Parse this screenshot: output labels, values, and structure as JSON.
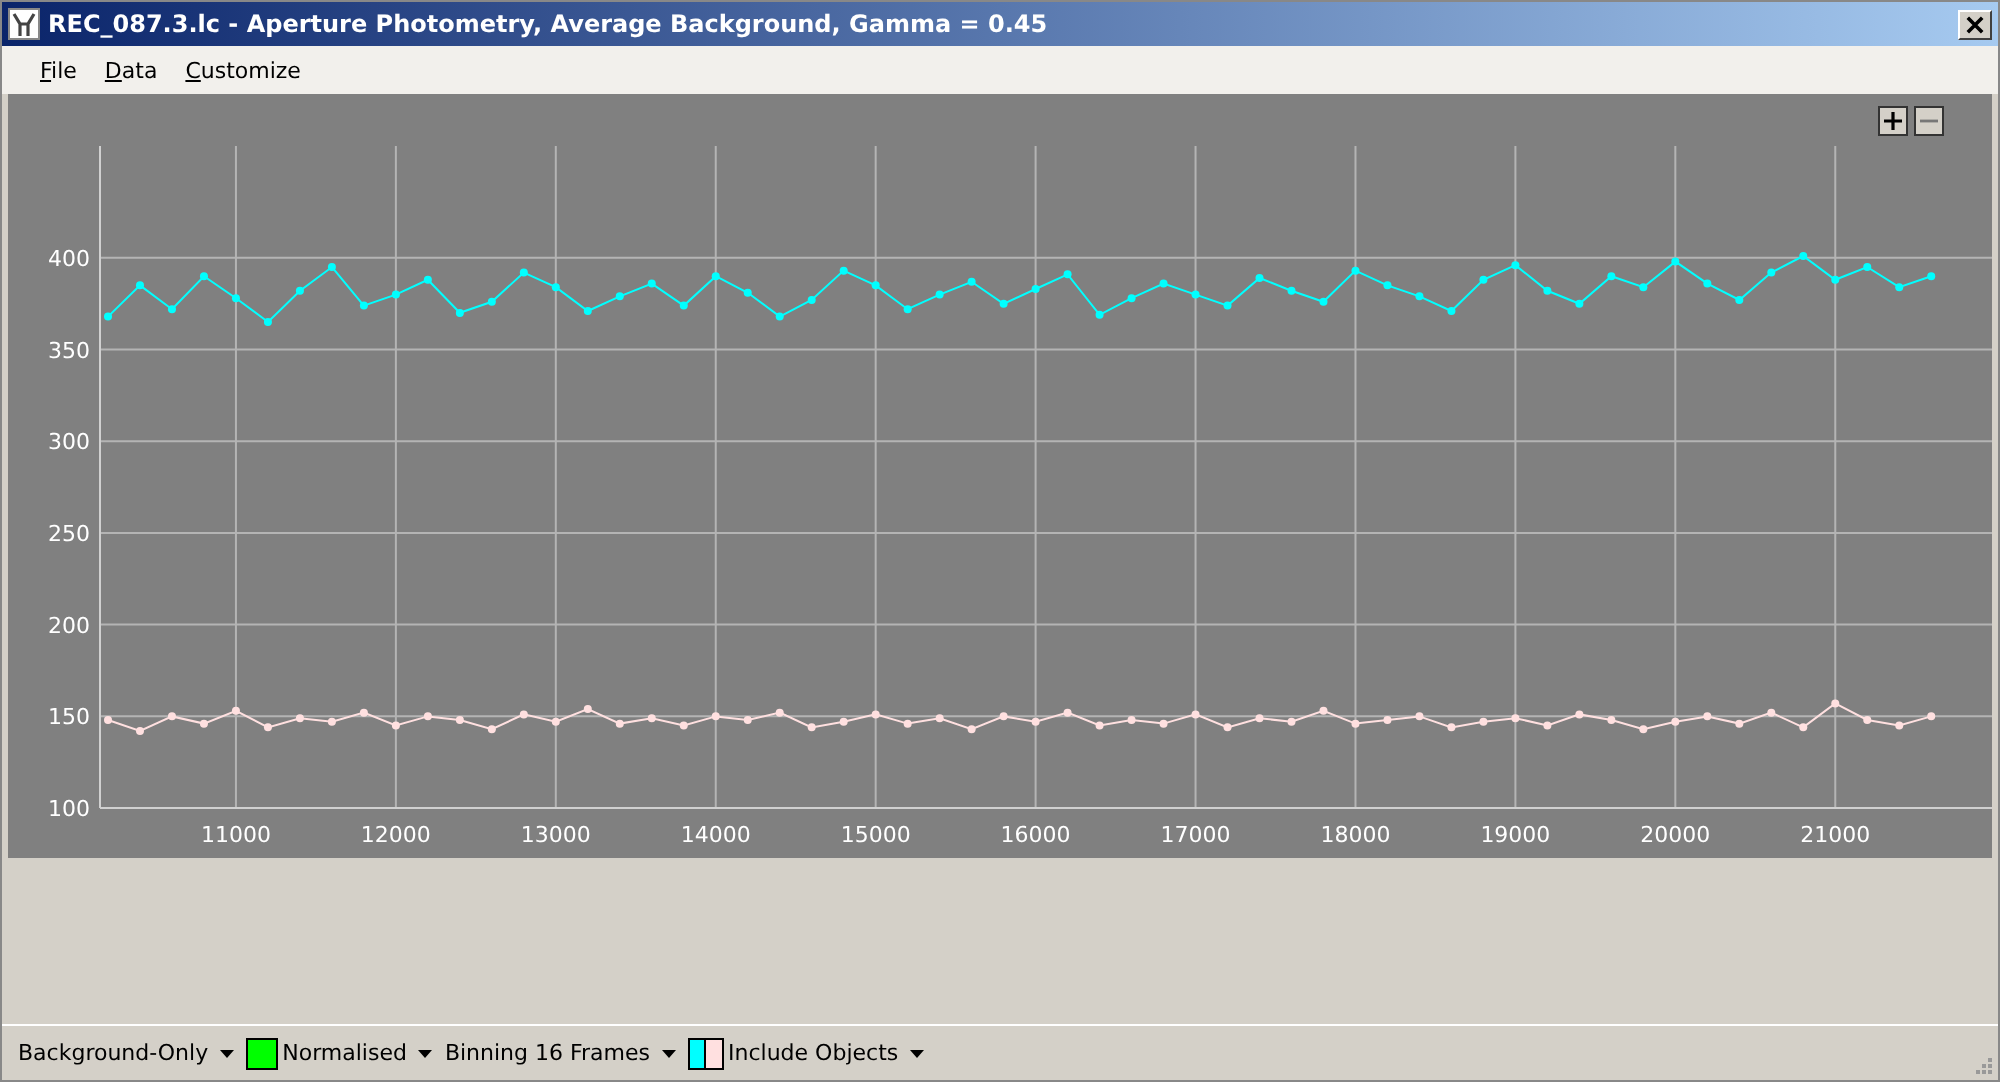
{
  "window": {
    "title": "REC_087.3.lc - Aperture Photometry, Average Background, Gamma = 0.45"
  },
  "menu": [
    "File",
    "Data",
    "Customize"
  ],
  "chart": {
    "chart_data": {
      "type": "line",
      "grid": true,
      "xlim": [
        10150,
        21980
      ],
      "ylim": [
        100,
        461
      ],
      "xticks": [
        11000,
        12000,
        13000,
        14000,
        15000,
        16000,
        17000,
        18000,
        19000,
        20000,
        21000
      ],
      "yticks": [
        100,
        150,
        200,
        250,
        300,
        350,
        400
      ],
      "x": [
        10200,
        10400,
        10600,
        10800,
        11000,
        11200,
        11400,
        11600,
        11800,
        12000,
        12200,
        12400,
        12600,
        12800,
        13000,
        13200,
        13400,
        13600,
        13800,
        14000,
        14200,
        14400,
        14600,
        14800,
        15000,
        15200,
        15400,
        15600,
        15800,
        16000,
        16200,
        16400,
        16600,
        16800,
        17000,
        17200,
        17400,
        17600,
        17800,
        18000,
        18200,
        18400,
        18600,
        18800,
        19000,
        19200,
        19400,
        19600,
        19800,
        20000,
        20200,
        20400,
        20600,
        20800,
        21000,
        21200,
        21400,
        21600
      ],
      "series": [
        {
          "color": "#00ffff",
          "marker": true,
          "values": [
            368,
            385,
            372,
            390,
            378,
            365,
            382,
            395,
            374,
            380,
            388,
            370,
            376,
            392,
            384,
            371,
            379,
            386,
            374,
            390,
            381,
            368,
            377,
            393,
            385,
            372,
            380,
            387,
            375,
            383,
            391,
            369,
            378,
            386,
            380,
            374,
            389,
            382,
            376,
            393,
            385,
            379,
            371,
            388,
            396,
            382,
            375,
            390,
            384,
            398,
            386,
            377,
            392,
            401,
            388,
            395,
            384,
            390
          ]
        },
        {
          "color": "#ffe0e0",
          "marker": true,
          "values": [
            148,
            142,
            150,
            146,
            153,
            144,
            149,
            147,
            152,
            145,
            150,
            148,
            143,
            151,
            147,
            154,
            146,
            149,
            145,
            150,
            148,
            152,
            144,
            147,
            151,
            146,
            149,
            143,
            150,
            147,
            152,
            145,
            148,
            146,
            151,
            144,
            149,
            147,
            153,
            146,
            148,
            150,
            144,
            147,
            149,
            145,
            151,
            148,
            143,
            147,
            150,
            146,
            152,
            144,
            157,
            148,
            145,
            150
          ]
        }
      ]
    }
  },
  "toolbar": [
    {
      "label": "Background-Only"
    },
    {
      "label": "Normalised",
      "swatches": [
        {
          "color": "#00ff00"
        }
      ]
    },
    {
      "label": "Binning 16 Frames"
    },
    {
      "label": "Include Objects",
      "swatches": [
        {
          "color": "#00ffff"
        },
        {
          "color": "#ffe0e0"
        }
      ]
    }
  ]
}
